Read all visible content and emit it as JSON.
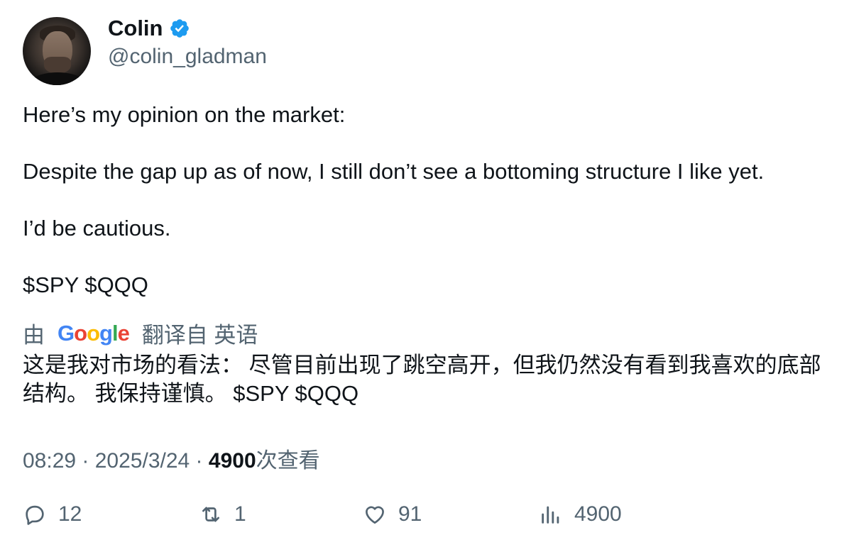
{
  "author": {
    "display_name": "Colin",
    "handle": "@colin_gladman",
    "verified_icon": "verified-badge-icon",
    "verified_color": "#1d9bf0"
  },
  "tweet": {
    "lines": [
      "Here’s my opinion on the market:",
      "Despite the gap up as of now, I still don’t see a bottoming structure I like yet.",
      "I’d be cautious.",
      "$SPY $QQQ"
    ]
  },
  "translation": {
    "prefix": "由",
    "provider": "Google",
    "suffix": "翻译自 英语",
    "text": "这是我对市场的看法： 尽管目前出现了跳空高开，但我仍然没有看到我喜欢的底部结构。 我保持谨慎。 $SPY $QQQ"
  },
  "meta": {
    "time": "08:29",
    "separator": " · ",
    "date": "2025/3/24",
    "views_count": "4900",
    "views_label": "次查看"
  },
  "actions": {
    "reply_count": "12",
    "retweet_count": "1",
    "like_count": "91",
    "views_count": "4900"
  },
  "colors": {
    "text": "#0f1419",
    "secondary": "#536471",
    "accent": "#1d9bf0"
  }
}
